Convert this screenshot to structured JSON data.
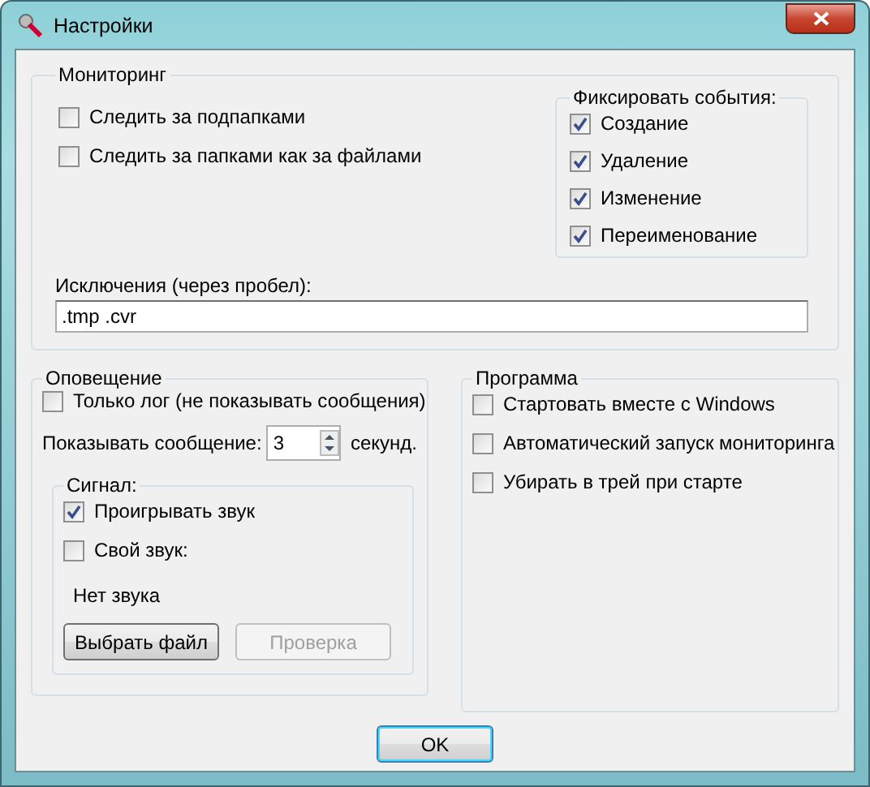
{
  "window": {
    "title": "Настройки"
  },
  "monitoring": {
    "title": "Мониторинг",
    "options": [
      {
        "label": "Следить за подпапками",
        "checked": false
      },
      {
        "label": "Следить за папками как за файлами",
        "checked": false
      }
    ],
    "events": {
      "title": "Фиксировать события:",
      "items": [
        {
          "label": "Создание",
          "checked": true
        },
        {
          "label": "Удаление",
          "checked": true
        },
        {
          "label": "Изменение",
          "checked": true
        },
        {
          "label": "Переименование",
          "checked": true
        }
      ]
    },
    "exclusions": {
      "label": "Исключения (через пробел):",
      "value": ".tmp .cvr"
    }
  },
  "notification": {
    "title": "Оповещение",
    "log_only": {
      "label": "Только лог (не показывать сообщения)",
      "checked": false
    },
    "show_message": {
      "label": "Показывать сообщение:",
      "value": "3",
      "unit": "секунд."
    },
    "signal": {
      "title": "Сигнал:",
      "options": [
        {
          "label": "Проигрывать звук",
          "checked": true
        },
        {
          "label": "Свой звук:",
          "checked": false
        }
      ],
      "sound_name": "Нет звука",
      "buttons": [
        {
          "label": "Выбрать файл",
          "disabled": false
        },
        {
          "label": "Проверка",
          "disabled": true
        }
      ]
    }
  },
  "program": {
    "title": "Программа",
    "options": [
      {
        "label": "Стартовать вместе с Windows",
        "checked": false
      },
      {
        "label": "Автоматический запуск мониторинга",
        "checked": false
      },
      {
        "label": "Убирать в трей при старте",
        "checked": false
      }
    ]
  },
  "ok_button": "OK"
}
